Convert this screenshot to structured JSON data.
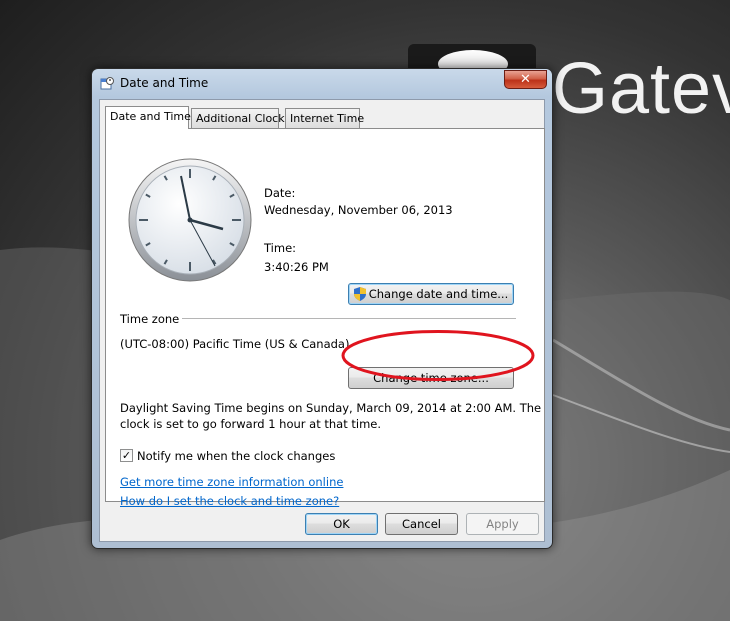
{
  "desktop": {
    "brand_text": "Gatev"
  },
  "window": {
    "title": "Date and Time",
    "close_label": "✕"
  },
  "tabs": [
    {
      "label": "Date and Time",
      "active": true
    },
    {
      "label": "Additional Clocks",
      "active": false
    },
    {
      "label": "Internet Time",
      "active": false
    }
  ],
  "datetime": {
    "date_label": "Date:",
    "date_value": "Wednesday, November 06, 2013",
    "time_label": "Time:",
    "time_value": "3:40:26 PM",
    "change_button": "Change date and time..."
  },
  "timezone": {
    "section_label": "Time zone",
    "value": "(UTC-08:00) Pacific Time (US & Canada)",
    "change_button": "Change time zone..."
  },
  "dst": {
    "line1": "Daylight Saving Time begins on Sunday, March 09, 2014 at 2:00 AM. The",
    "line2": "clock is set to go forward 1 hour at that time."
  },
  "notify": {
    "label": "Notify me when the clock changes",
    "checked": true,
    "check_mark": "✓"
  },
  "links": {
    "more_info": "Get more time zone information online",
    "how_to": "How do I set the clock and time zone?"
  },
  "buttons": {
    "ok": "OK",
    "cancel": "Cancel",
    "apply": "Apply"
  },
  "icons": {
    "window_icon": "clock-calendar-icon",
    "shield": "uac-shield-icon"
  },
  "colors": {
    "link": "#0066cc",
    "annotation": "#e0141e",
    "close_button": "#c4331c"
  }
}
